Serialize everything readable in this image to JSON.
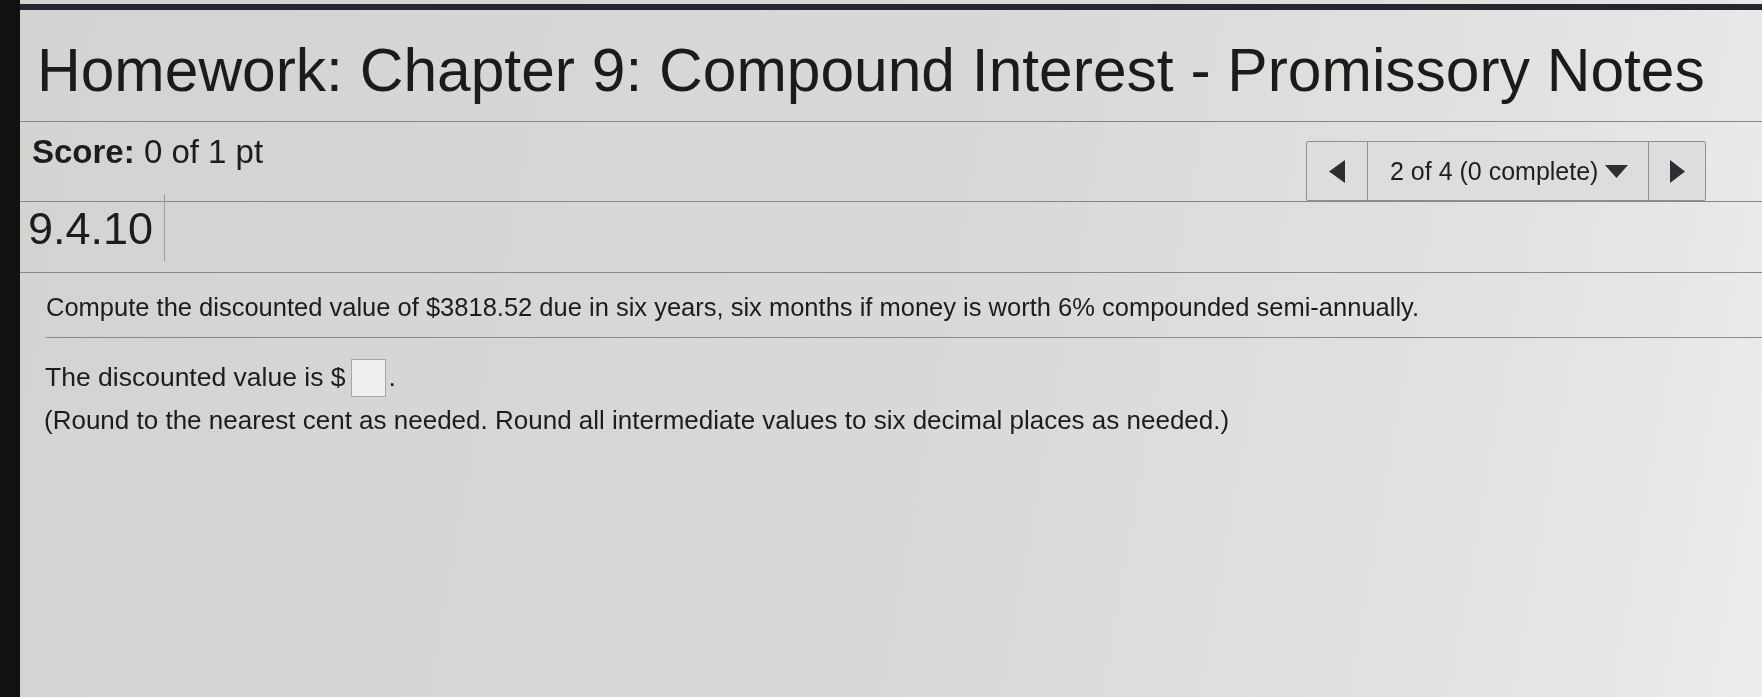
{
  "header": {
    "title": "Homework: Chapter 9: Compound Interest - Promissory Notes"
  },
  "score": {
    "text": "**Score:** 0 of 1 pt"
  },
  "navigator": {
    "position": "2 of 4 (0 complete)"
  },
  "question": {
    "number": "9.4.10",
    "prompt": "Compute the discounted value of $3818.52 due in six years, six months if money is worth 6% compounded semi-annually.",
    "answer": {
      "prefix": "The discounted value is $",
      "suffix": "."
    },
    "instructions": "(Round to the nearest cent as needed. Round all intermediate values to six decimal places as needed.)"
  }
}
